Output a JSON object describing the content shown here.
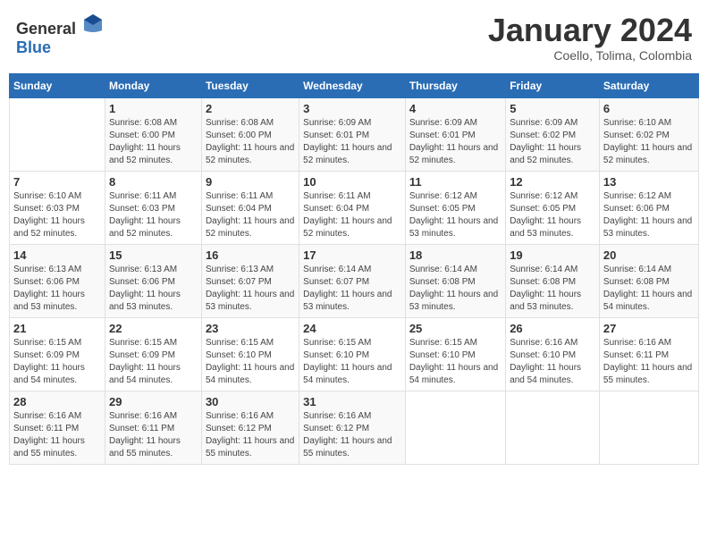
{
  "header": {
    "logo_general": "General",
    "logo_blue": "Blue",
    "month_title": "January 2024",
    "location": "Coello, Tolima, Colombia"
  },
  "days_of_week": [
    "Sunday",
    "Monday",
    "Tuesday",
    "Wednesday",
    "Thursday",
    "Friday",
    "Saturday"
  ],
  "weeks": [
    [
      {
        "day": "",
        "sunrise": "",
        "sunset": "",
        "daylight": ""
      },
      {
        "day": "1",
        "sunrise": "Sunrise: 6:08 AM",
        "sunset": "Sunset: 6:00 PM",
        "daylight": "Daylight: 11 hours and 52 minutes."
      },
      {
        "day": "2",
        "sunrise": "Sunrise: 6:08 AM",
        "sunset": "Sunset: 6:00 PM",
        "daylight": "Daylight: 11 hours and 52 minutes."
      },
      {
        "day": "3",
        "sunrise": "Sunrise: 6:09 AM",
        "sunset": "Sunset: 6:01 PM",
        "daylight": "Daylight: 11 hours and 52 minutes."
      },
      {
        "day": "4",
        "sunrise": "Sunrise: 6:09 AM",
        "sunset": "Sunset: 6:01 PM",
        "daylight": "Daylight: 11 hours and 52 minutes."
      },
      {
        "day": "5",
        "sunrise": "Sunrise: 6:09 AM",
        "sunset": "Sunset: 6:02 PM",
        "daylight": "Daylight: 11 hours and 52 minutes."
      },
      {
        "day": "6",
        "sunrise": "Sunrise: 6:10 AM",
        "sunset": "Sunset: 6:02 PM",
        "daylight": "Daylight: 11 hours and 52 minutes."
      }
    ],
    [
      {
        "day": "7",
        "sunrise": "Sunrise: 6:10 AM",
        "sunset": "Sunset: 6:03 PM",
        "daylight": "Daylight: 11 hours and 52 minutes."
      },
      {
        "day": "8",
        "sunrise": "Sunrise: 6:11 AM",
        "sunset": "Sunset: 6:03 PM",
        "daylight": "Daylight: 11 hours and 52 minutes."
      },
      {
        "day": "9",
        "sunrise": "Sunrise: 6:11 AM",
        "sunset": "Sunset: 6:04 PM",
        "daylight": "Daylight: 11 hours and 52 minutes."
      },
      {
        "day": "10",
        "sunrise": "Sunrise: 6:11 AM",
        "sunset": "Sunset: 6:04 PM",
        "daylight": "Daylight: 11 hours and 52 minutes."
      },
      {
        "day": "11",
        "sunrise": "Sunrise: 6:12 AM",
        "sunset": "Sunset: 6:05 PM",
        "daylight": "Daylight: 11 hours and 53 minutes."
      },
      {
        "day": "12",
        "sunrise": "Sunrise: 6:12 AM",
        "sunset": "Sunset: 6:05 PM",
        "daylight": "Daylight: 11 hours and 53 minutes."
      },
      {
        "day": "13",
        "sunrise": "Sunrise: 6:12 AM",
        "sunset": "Sunset: 6:06 PM",
        "daylight": "Daylight: 11 hours and 53 minutes."
      }
    ],
    [
      {
        "day": "14",
        "sunrise": "Sunrise: 6:13 AM",
        "sunset": "Sunset: 6:06 PM",
        "daylight": "Daylight: 11 hours and 53 minutes."
      },
      {
        "day": "15",
        "sunrise": "Sunrise: 6:13 AM",
        "sunset": "Sunset: 6:06 PM",
        "daylight": "Daylight: 11 hours and 53 minutes."
      },
      {
        "day": "16",
        "sunrise": "Sunrise: 6:13 AM",
        "sunset": "Sunset: 6:07 PM",
        "daylight": "Daylight: 11 hours and 53 minutes."
      },
      {
        "day": "17",
        "sunrise": "Sunrise: 6:14 AM",
        "sunset": "Sunset: 6:07 PM",
        "daylight": "Daylight: 11 hours and 53 minutes."
      },
      {
        "day": "18",
        "sunrise": "Sunrise: 6:14 AM",
        "sunset": "Sunset: 6:08 PM",
        "daylight": "Daylight: 11 hours and 53 minutes."
      },
      {
        "day": "19",
        "sunrise": "Sunrise: 6:14 AM",
        "sunset": "Sunset: 6:08 PM",
        "daylight": "Daylight: 11 hours and 53 minutes."
      },
      {
        "day": "20",
        "sunrise": "Sunrise: 6:14 AM",
        "sunset": "Sunset: 6:08 PM",
        "daylight": "Daylight: 11 hours and 54 minutes."
      }
    ],
    [
      {
        "day": "21",
        "sunrise": "Sunrise: 6:15 AM",
        "sunset": "Sunset: 6:09 PM",
        "daylight": "Daylight: 11 hours and 54 minutes."
      },
      {
        "day": "22",
        "sunrise": "Sunrise: 6:15 AM",
        "sunset": "Sunset: 6:09 PM",
        "daylight": "Daylight: 11 hours and 54 minutes."
      },
      {
        "day": "23",
        "sunrise": "Sunrise: 6:15 AM",
        "sunset": "Sunset: 6:10 PM",
        "daylight": "Daylight: 11 hours and 54 minutes."
      },
      {
        "day": "24",
        "sunrise": "Sunrise: 6:15 AM",
        "sunset": "Sunset: 6:10 PM",
        "daylight": "Daylight: 11 hours and 54 minutes."
      },
      {
        "day": "25",
        "sunrise": "Sunrise: 6:15 AM",
        "sunset": "Sunset: 6:10 PM",
        "daylight": "Daylight: 11 hours and 54 minutes."
      },
      {
        "day": "26",
        "sunrise": "Sunrise: 6:16 AM",
        "sunset": "Sunset: 6:10 PM",
        "daylight": "Daylight: 11 hours and 54 minutes."
      },
      {
        "day": "27",
        "sunrise": "Sunrise: 6:16 AM",
        "sunset": "Sunset: 6:11 PM",
        "daylight": "Daylight: 11 hours and 55 minutes."
      }
    ],
    [
      {
        "day": "28",
        "sunrise": "Sunrise: 6:16 AM",
        "sunset": "Sunset: 6:11 PM",
        "daylight": "Daylight: 11 hours and 55 minutes."
      },
      {
        "day": "29",
        "sunrise": "Sunrise: 6:16 AM",
        "sunset": "Sunset: 6:11 PM",
        "daylight": "Daylight: 11 hours and 55 minutes."
      },
      {
        "day": "30",
        "sunrise": "Sunrise: 6:16 AM",
        "sunset": "Sunset: 6:12 PM",
        "daylight": "Daylight: 11 hours and 55 minutes."
      },
      {
        "day": "31",
        "sunrise": "Sunrise: 6:16 AM",
        "sunset": "Sunset: 6:12 PM",
        "daylight": "Daylight: 11 hours and 55 minutes."
      },
      {
        "day": "",
        "sunrise": "",
        "sunset": "",
        "daylight": ""
      },
      {
        "day": "",
        "sunrise": "",
        "sunset": "",
        "daylight": ""
      },
      {
        "day": "",
        "sunrise": "",
        "sunset": "",
        "daylight": ""
      }
    ]
  ]
}
